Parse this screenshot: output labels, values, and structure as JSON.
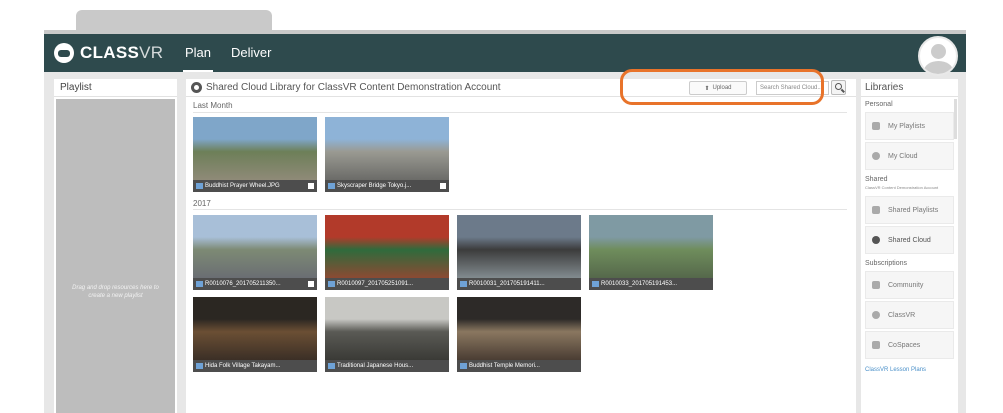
{
  "brand": {
    "name_bold": "CLASS",
    "name_light": "VR"
  },
  "nav": {
    "items": [
      "Plan",
      "Deliver"
    ],
    "active": "Plan"
  },
  "playlist": {
    "title": "Playlist",
    "hint": "Drag and drop resources here to create a new playlist"
  },
  "main": {
    "title": "Shared Cloud Library for ClassVR Content Demonstration Account",
    "upload_label": "Upload",
    "search_placeholder": "Search Shared Cloud..."
  },
  "sections": [
    {
      "label": "Last Month",
      "items": [
        {
          "caption": "Buddhist Prayer Wheel.JPG",
          "colors": [
            "#7fa6c9",
            "#6d7f58",
            "#8f8a78"
          ]
        },
        {
          "caption": "Skyscraper Bridge Tokyo.j...",
          "colors": [
            "#8eb3d7",
            "#9a9a92",
            "#6b6b68"
          ]
        }
      ]
    },
    {
      "label": "2017",
      "items": [
        {
          "caption": "R0010076_201705211350...",
          "colors": [
            "#a8bfd8",
            "#7d8a74",
            "#6a6e73"
          ]
        },
        {
          "caption": "R0010097_201705251091...",
          "colors": [
            "#b23a2a",
            "#2f6b3c",
            "#8c4a33"
          ]
        },
        {
          "caption": "R0010031_201705191411...",
          "colors": [
            "#6c7a8a",
            "#3c3c3c",
            "#828b8f"
          ]
        },
        {
          "caption": "R0010033_201705191453...",
          "colors": [
            "#7f9aa3",
            "#6f8d5c",
            "#55684b"
          ]
        },
        {
          "caption": "Hida Folk Village Takayam...",
          "colors": [
            "#2b2722",
            "#6b4f34",
            "#3b2f26"
          ]
        },
        {
          "caption": "Traditional Japanese Hous...",
          "colors": [
            "#c8c8c4",
            "#5a5a55",
            "#3a3a36"
          ]
        },
        {
          "caption": "Buddhist Temple Memori...",
          "colors": [
            "#2d2a28",
            "#8a7760",
            "#4a3d33"
          ]
        }
      ]
    }
  ],
  "libraries": {
    "title": "Libraries",
    "personal_label": "Personal",
    "my_playlists": "My Playlists",
    "my_cloud": "My Cloud",
    "shared_label": "Shared",
    "shared_account": "ClassVR Content Demonstration Account",
    "shared_playlists": "Shared Playlists",
    "shared_cloud": "Shared Cloud",
    "subscriptions_label": "Subscriptions",
    "community": "Community",
    "classvr": "ClassVR",
    "cospaces": "CoSpaces",
    "lesson_plans": "ClassVR Lesson Plans"
  },
  "accent": "#e8732a"
}
